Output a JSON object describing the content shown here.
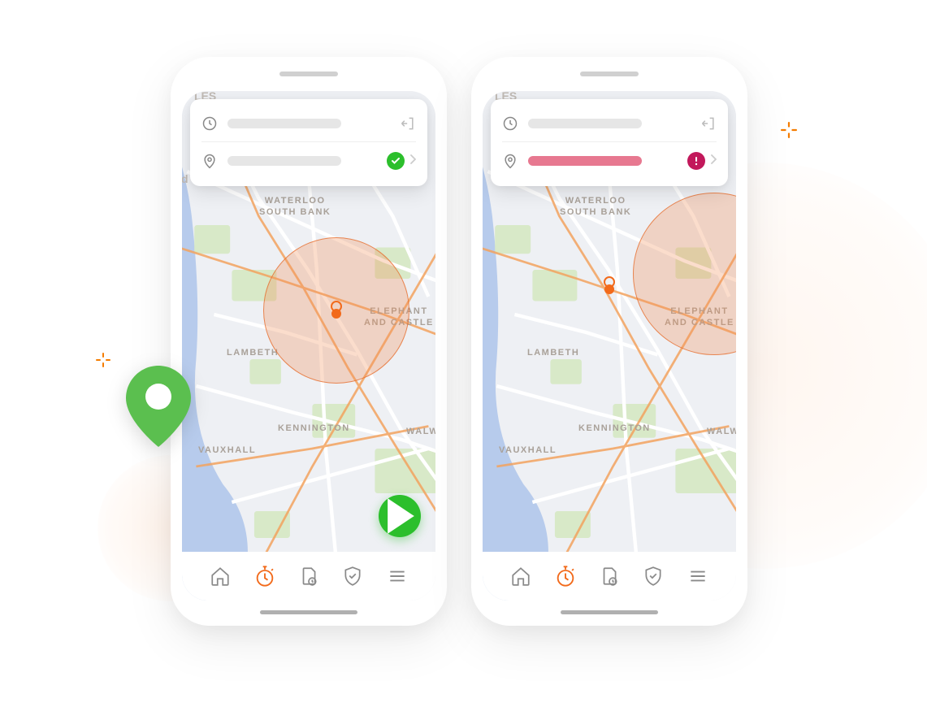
{
  "decor": {
    "accent_color": "#f57c00",
    "success_color": "#2cbf2c",
    "error_color": "#c2185b"
  },
  "map_labels": {
    "waterloo": "WATERLOO\nSOUTH BANK",
    "lambeth": "LAMBETH",
    "elephant": "ELEPHANT\nAND CASTLE",
    "kennington": "KENNINGTON",
    "vauxhall": "VAUXHALL",
    "walw": "WALW",
    "les_partial": "LES",
    "d_partial": "d"
  },
  "phones": [
    {
      "id": "phone-inside",
      "card": {
        "row1": {
          "icon": "clock",
          "bar_style": "grey",
          "trailing_icon": "exit"
        },
        "row2": {
          "icon": "location-pin",
          "bar_style": "grey",
          "status": "ok",
          "chevron": true
        }
      },
      "geofence": {
        "contains_user": true
      },
      "show_play_fab": true
    },
    {
      "id": "phone-outside",
      "card": {
        "row1": {
          "icon": "clock",
          "bar_style": "grey",
          "trailing_icon": "exit"
        },
        "row2": {
          "icon": "location-pin",
          "bar_style": "red",
          "status": "error",
          "chevron": true
        }
      },
      "geofence": {
        "contains_user": false
      },
      "show_play_fab": false
    }
  ],
  "nav": {
    "items": [
      {
        "icon": "home",
        "active": false
      },
      {
        "icon": "stopwatch",
        "active": true
      },
      {
        "icon": "document-clock",
        "active": false
      },
      {
        "icon": "shield-check",
        "active": false
      },
      {
        "icon": "menu",
        "active": false
      }
    ]
  }
}
